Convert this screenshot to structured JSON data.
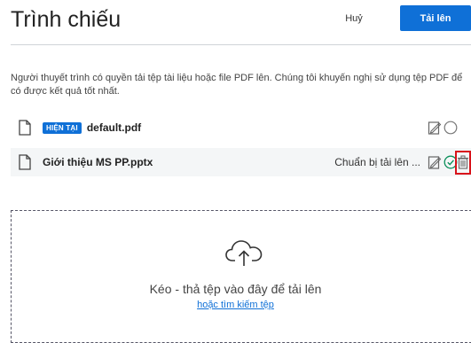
{
  "header": {
    "title": "Trình chiếu",
    "cancel_label": "Huỷ",
    "upload_label": "Tải lên"
  },
  "description": "Người thuyết trình có quyền tải tệp tài liệu hoặc file PDF lên. Chúng tôi khuyến nghị sử dụng tệp PDF để có được kết quả tốt nhất.",
  "files": [
    {
      "badge": "HIỆN TẠI",
      "name": "default.pdf",
      "icon": "file-icon",
      "actions": [
        "edit-icon",
        "radio-icon"
      ]
    },
    {
      "name": "Giới thiệu MS PP.pptx",
      "status": "Chuẩn bị tải lên ...",
      "icon": "file-icon",
      "actions": [
        "edit-icon",
        "check-circle-icon",
        "trash-icon"
      ]
    }
  ],
  "dropzone": {
    "icon": "cloud-upload-icon",
    "text": "Kéo - thả tệp vào đây để tải lên",
    "link": "hoặc tìm kiếm tệp"
  },
  "colors": {
    "accent": "#0f70d7",
    "highlight": "#d8131b",
    "row_bg": "#f4f6f7"
  }
}
